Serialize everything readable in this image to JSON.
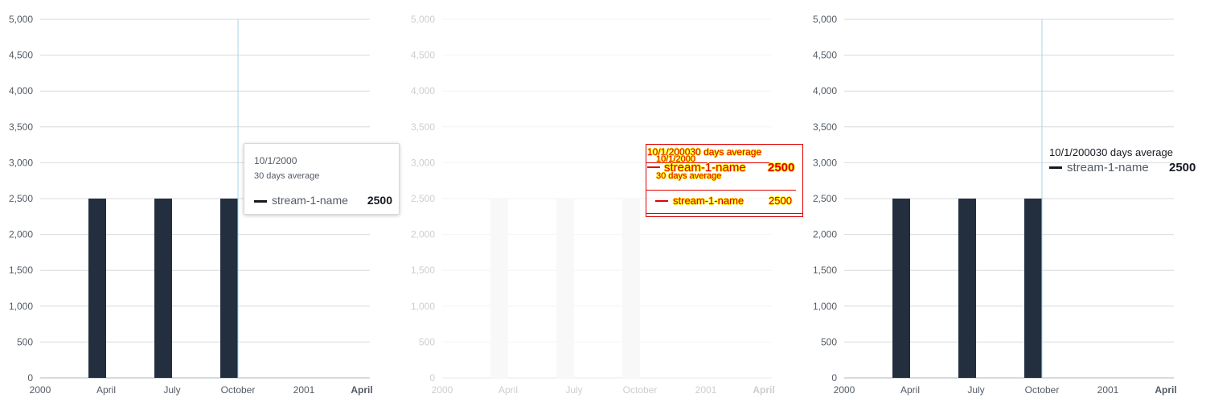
{
  "chart_data": [
    {
      "type": "bar",
      "x": [
        "2000-01",
        "2000-04",
        "2000-07",
        "2000-10",
        "2001-01",
        "2001-04"
      ],
      "series": [
        {
          "name": "stream-1-name",
          "values": [
            null,
            2500,
            2500,
            2500,
            null,
            null
          ]
        }
      ],
      "xticks": [
        "2000",
        "April",
        "July",
        "October",
        "2001",
        "April"
      ],
      "yticks": [
        "0",
        "500",
        "1,000",
        "1,500",
        "2,000",
        "2,500",
        "3,000",
        "3,500",
        "4,000",
        "4,500",
        "5,000"
      ],
      "ylim": [
        0,
        5000
      ],
      "grid": true,
      "bar_color": "#232f3e",
      "highlight": "October",
      "tooltip": {
        "date": "10/1/2000",
        "subtitle": "30 days average",
        "series": "stream-1-name",
        "value": "2500"
      }
    },
    {
      "type": "bar",
      "x": [
        "2000-01",
        "2000-04",
        "2000-07",
        "2000-10",
        "2001-01",
        "2001-04"
      ],
      "series": [
        {
          "name": "stream-1-name",
          "values": [
            null,
            2500,
            2500,
            2500,
            null,
            null
          ]
        }
      ],
      "xticks": [
        "2000",
        "April",
        "July",
        "October",
        "2001",
        "April"
      ],
      "yticks": [
        "0",
        "500",
        "1,000",
        "1,500",
        "2,000",
        "2,500",
        "3,000",
        "3,500",
        "4,000",
        "4,500",
        "5,000"
      ],
      "ylim": [
        0,
        5000
      ],
      "grid": true,
      "bar_color": "#e9e9e9",
      "faded": true,
      "tooltip": {
        "header": "10/1/200030 days average",
        "date": "10/1/2000",
        "subtitle": "30 days average",
        "series": "stream-1-name",
        "value": "2500"
      }
    },
    {
      "type": "bar",
      "x": [
        "2000-01",
        "2000-04",
        "2000-07",
        "2000-10",
        "2001-01",
        "2001-04"
      ],
      "series": [
        {
          "name": "stream-1-name",
          "values": [
            null,
            2500,
            2500,
            2500,
            null,
            null
          ]
        }
      ],
      "xticks": [
        "2000",
        "April",
        "July",
        "October",
        "2001",
        "April"
      ],
      "yticks": [
        "0",
        "500",
        "1,000",
        "1,500",
        "2,000",
        "2,500",
        "3,000",
        "3,500",
        "4,000",
        "4,500",
        "5,000"
      ],
      "ylim": [
        0,
        5000
      ],
      "grid": true,
      "bar_color": "#232f3e",
      "highlight": "October",
      "tooltip": {
        "header": "10/1/200030 days average",
        "series": "stream-1-name",
        "value": "2500"
      }
    }
  ],
  "colors": {
    "grid": "#d5dbdb",
    "tick_text": "#545b64",
    "crosshair": "#a6d4ee",
    "debug": "#e00000",
    "debug_outline": "#ffeb00"
  }
}
